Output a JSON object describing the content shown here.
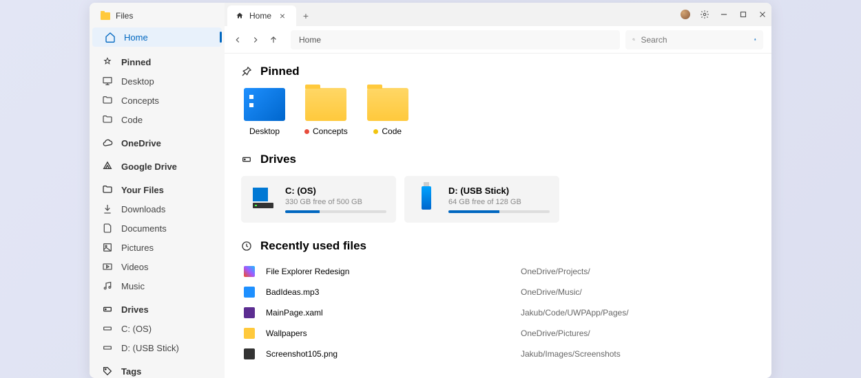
{
  "appTitle": "Files",
  "tab": {
    "label": "Home"
  },
  "toolbar": {
    "breadcrumb": "Home"
  },
  "search": {
    "placeholder": "Search"
  },
  "sidebar": {
    "home": "Home",
    "pinned": {
      "label": "Pinned",
      "items": [
        "Desktop",
        "Concepts",
        "Code"
      ]
    },
    "onedrive": "OneDrive",
    "gdrive": "Google Drive",
    "files": {
      "label": "Your Files",
      "items": [
        "Downloads",
        "Documents",
        "Pictures",
        "Videos",
        "Music"
      ]
    },
    "drives": {
      "label": "Drives",
      "items": [
        "C: (OS)",
        "D: (USB Stick)"
      ]
    },
    "tags": "Tags"
  },
  "sections": {
    "pinned": {
      "title": "Pinned",
      "items": [
        {
          "label": "Desktop",
          "dot": null
        },
        {
          "label": "Concepts",
          "dot": "#e74c3c"
        },
        {
          "label": "Code",
          "dot": "#f1c40f"
        }
      ]
    },
    "drives": {
      "title": "Drives",
      "items": [
        {
          "name": "C: (OS)",
          "stat": "330 GB free of 500 GB",
          "pct": 34
        },
        {
          "name": "D: (USB Stick)",
          "stat": "64 GB free of 128 GB",
          "pct": 50
        }
      ]
    },
    "recent": {
      "title": "Recently used files",
      "items": [
        {
          "name": "File Explorer Redesign",
          "path": "OneDrive/Projects/",
          "color": "#a259ff"
        },
        {
          "name": "BadIdeas.mp3",
          "path": "OneDrive/Music/",
          "color": "#1e90ff"
        },
        {
          "name": "MainPage.xaml",
          "path": "Jakub/Code/UWPApp/Pages/",
          "color": "#5c2d91"
        },
        {
          "name": "Wallpapers",
          "path": "OneDrive/Pictures/",
          "color": "#ffc93c"
        },
        {
          "name": "Screenshot105.png",
          "path": "Jakub/Images/Screenshots",
          "color": "#333"
        }
      ]
    }
  }
}
